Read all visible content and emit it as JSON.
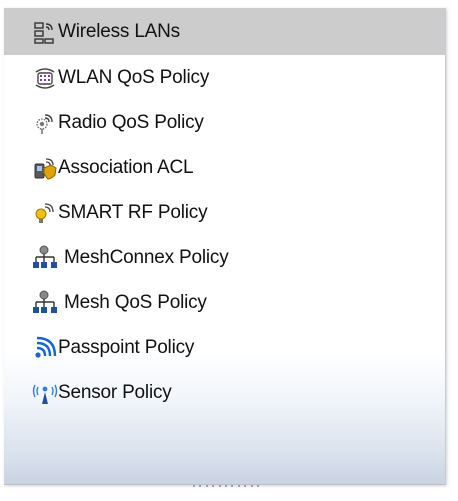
{
  "menu": {
    "items": [
      {
        "label": "Wireless LANs",
        "icon": "wireless-lan-icon",
        "selected": true
      },
      {
        "label": "WLAN QoS Policy",
        "icon": "wlan-qos-icon",
        "selected": false
      },
      {
        "label": "Radio QoS Policy",
        "icon": "radio-qos-icon",
        "selected": false
      },
      {
        "label": "Association ACL",
        "icon": "association-acl-icon",
        "selected": false
      },
      {
        "label": "SMART RF Policy",
        "icon": "smart-rf-icon",
        "selected": false
      },
      {
        "label": "MeshConnex Policy",
        "icon": "meshconnex-icon",
        "selected": false
      },
      {
        "label": "Mesh QoS Policy",
        "icon": "mesh-qos-icon",
        "selected": false
      },
      {
        "label": "Passpoint Policy",
        "icon": "passpoint-icon",
        "selected": false
      },
      {
        "label": "Sensor Policy",
        "icon": "sensor-icon",
        "selected": false
      }
    ]
  },
  "colors": {
    "selected_background": "#cccccc",
    "text": "#111111",
    "passpoint_blue": "#1565d8",
    "sensor_blue": "#2f7fe0",
    "acl_gold": "#e0a400"
  }
}
